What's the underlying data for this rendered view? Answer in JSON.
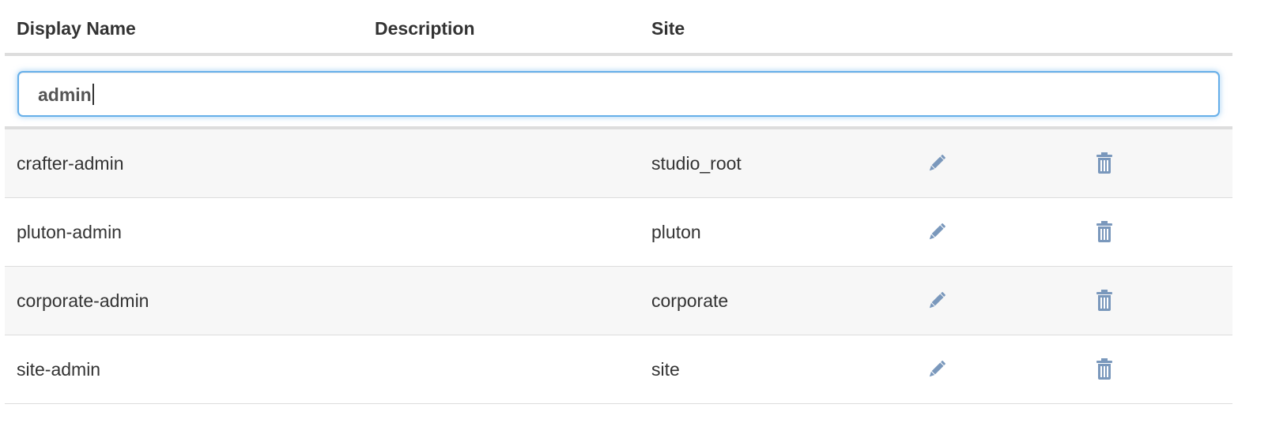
{
  "table": {
    "headers": {
      "display_name": "Display Name",
      "description": "Description",
      "site": "Site"
    },
    "filter": {
      "value": "admin"
    },
    "rows": [
      {
        "display_name": "crafter-admin",
        "description": "",
        "site": "studio_root"
      },
      {
        "display_name": "pluton-admin",
        "description": "",
        "site": "pluton"
      },
      {
        "display_name": "corporate-admin",
        "description": "",
        "site": "corporate"
      },
      {
        "display_name": "site-admin",
        "description": "",
        "site": "site"
      }
    ]
  },
  "icons": {
    "edit": "pencil-icon",
    "delete": "trash-icon"
  },
  "colors": {
    "icon": "#7a98bc",
    "focus_border": "#66afe9",
    "stripe": "#f7f7f7",
    "divider": "#dddddd"
  }
}
